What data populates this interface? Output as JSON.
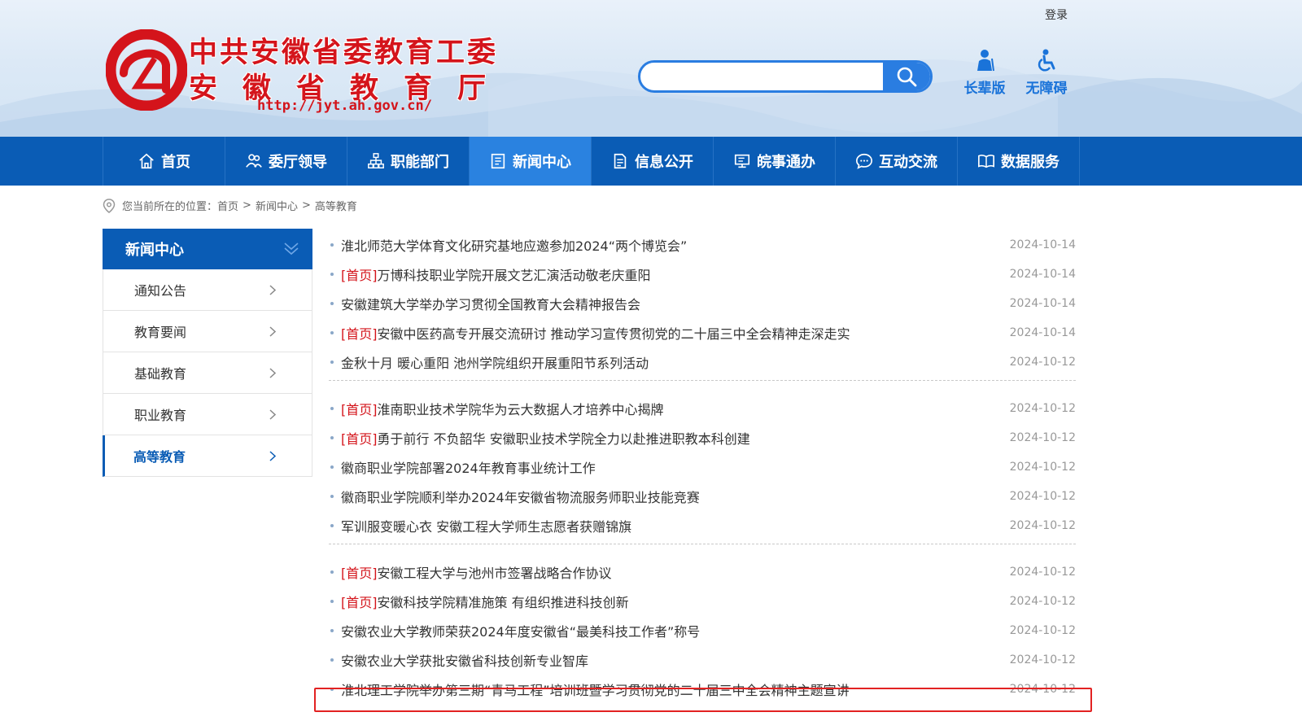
{
  "header": {
    "login": "登录",
    "org_title": "中共安徽省委教育工委",
    "dept_title": "安徽省教育厅",
    "url": "http://jyt.ah.gov.cn/",
    "search_placeholder": "",
    "elder_label": "长辈版",
    "access_label": "无障碍"
  },
  "nav": {
    "items": [
      {
        "label": "首页",
        "icon": "home-icon"
      },
      {
        "label": "委厅领导",
        "icon": "people-icon"
      },
      {
        "label": "职能部门",
        "icon": "org-chart-icon"
      },
      {
        "label": "新闻中心",
        "icon": "news-icon"
      },
      {
        "label": "信息公开",
        "icon": "document-icon"
      },
      {
        "label": "皖事通办",
        "icon": "monitor-icon"
      },
      {
        "label": "互动交流",
        "icon": "chat-icon"
      },
      {
        "label": "数据服务",
        "icon": "book-icon"
      }
    ],
    "active_index": 3
  },
  "breadcrumb": {
    "prefix": "您当前所在的位置：",
    "home": "首页",
    "section": "新闻中心",
    "current": "高等教育",
    "separator": ">"
  },
  "sidebar": {
    "title": "新闻中心",
    "items": [
      "通知公告",
      "教育要闻",
      "基础教育",
      "职业教育",
      "高等教育"
    ],
    "active_index": 4
  },
  "news": {
    "tag_text": "首页",
    "groups": [
      [
        {
          "tag": false,
          "title": "淮北师范大学体育文化研究基地应邀参加2024“两个博览会”",
          "date": "2024-10-14"
        },
        {
          "tag": true,
          "title": "万博科技职业学院开展文艺汇演活动敬老庆重阳",
          "date": "2024-10-14"
        },
        {
          "tag": false,
          "title": "安徽建筑大学举办学习贯彻全国教育大会精神报告会",
          "date": "2024-10-14"
        },
        {
          "tag": true,
          "title": "安徽中医药高专开展交流研讨 推动学习宣传贯彻党的二十届三中全会精神走深走实",
          "date": "2024-10-14"
        },
        {
          "tag": false,
          "title": "金秋十月 暖心重阳 池州学院组织开展重阳节系列活动",
          "date": "2024-10-12"
        }
      ],
      [
        {
          "tag": true,
          "title": "淮南职业技术学院华为云大数据人才培养中心揭牌",
          "date": "2024-10-12"
        },
        {
          "tag": true,
          "title": "勇于前行 不负韶华 安徽职业技术学院全力以赴推进职教本科创建",
          "date": "2024-10-12"
        },
        {
          "tag": false,
          "title": "徽商职业学院部署2024年教育事业统计工作",
          "date": "2024-10-12"
        },
        {
          "tag": false,
          "title": "徽商职业学院顺利举办2024年安徽省物流服务师职业技能竞赛",
          "date": "2024-10-12"
        },
        {
          "tag": false,
          "title": "军训服变暖心衣 安徽工程大学师生志愿者获赠锦旗",
          "date": "2024-10-12"
        }
      ],
      [
        {
          "tag": true,
          "title": "安徽工程大学与池州市签署战略合作协议",
          "date": "2024-10-12"
        },
        {
          "tag": true,
          "title": "安徽科技学院精准施策 有组织推进科技创新",
          "date": "2024-10-12"
        },
        {
          "tag": false,
          "title": "安徽农业大学教师荣获2024年度安徽省“最美科技工作者”称号",
          "date": "2024-10-12"
        },
        {
          "tag": false,
          "title": "安徽农业大学获批安徽省科技创新专业智库",
          "date": "2024-10-12"
        },
        {
          "tag": false,
          "title": "淮北理工学院举办第三期“青马工程”培训班暨学习贯彻党的二十届三中全会精神主题宣讲",
          "date": "2024-10-12"
        }
      ]
    ]
  },
  "colors": {
    "nav_bg": "#0a5cb5",
    "nav_active": "#2a82e0",
    "brand_red": "#d4141b",
    "highlight": "#e22222"
  }
}
